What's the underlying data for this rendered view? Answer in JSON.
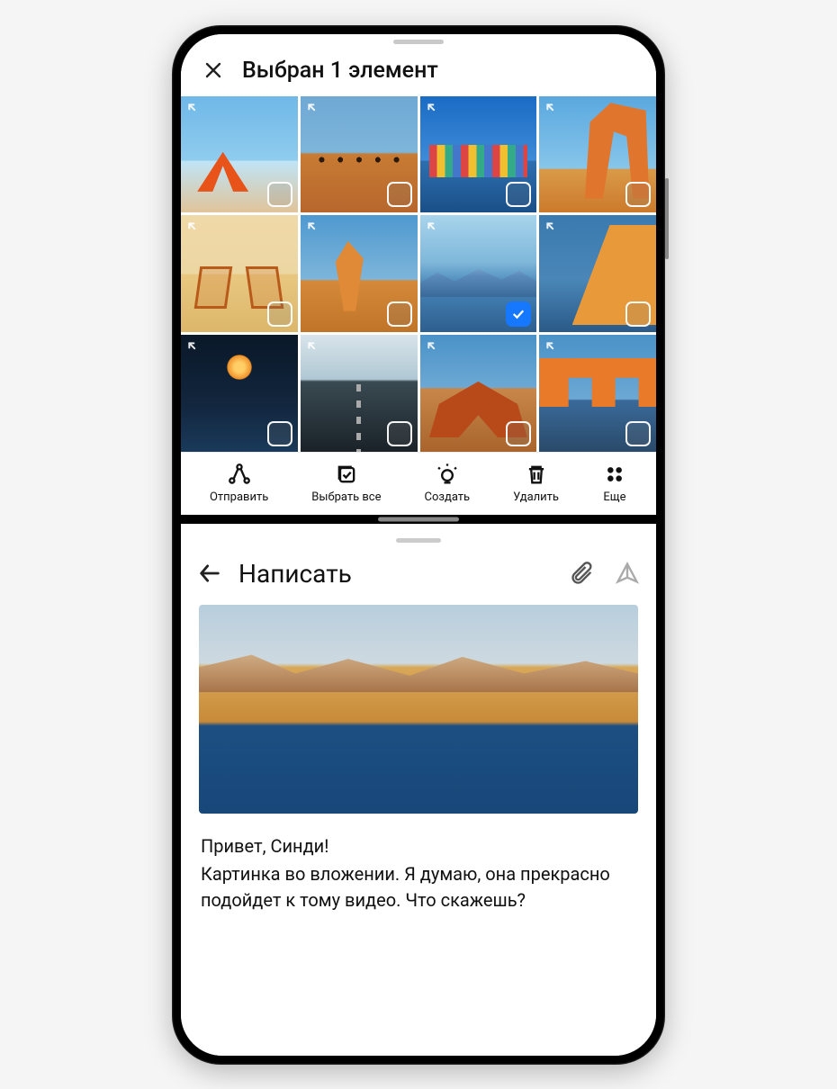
{
  "gallery": {
    "title": "Выбран 1 элемент",
    "thumbs": [
      {
        "checked": false
      },
      {
        "checked": false
      },
      {
        "checked": false
      },
      {
        "checked": false
      },
      {
        "checked": false
      },
      {
        "checked": false
      },
      {
        "checked": true
      },
      {
        "checked": false
      },
      {
        "checked": false
      },
      {
        "checked": false
      },
      {
        "checked": false
      },
      {
        "checked": false
      }
    ],
    "toolbar": {
      "share": "Отправить",
      "select_all": "Выбрать все",
      "create": "Создать",
      "delete": "Удалить",
      "more": "Еще"
    }
  },
  "compose": {
    "title": "Написать",
    "greeting": "Привет, Синди!",
    "body": "Картинка во вложении. Я думаю, она прекрасно подойдет к тому видео. Что скажешь?"
  }
}
